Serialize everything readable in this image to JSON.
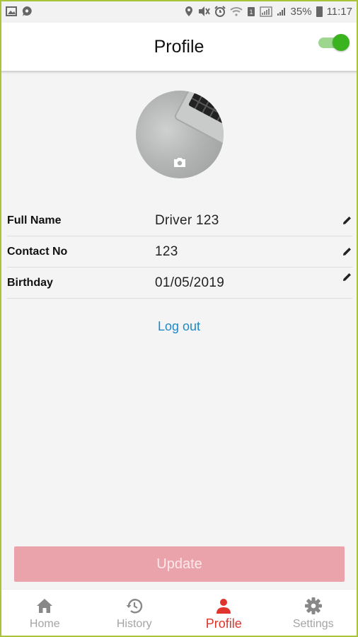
{
  "status_bar": {
    "battery_percent": "35%",
    "time": "11:17"
  },
  "header": {
    "title": "Profile",
    "toggle_on": true
  },
  "avatar": {
    "icon": "camera-icon"
  },
  "fields": [
    {
      "label": "Full Name",
      "value": "Driver 123"
    },
    {
      "label": "Contact No",
      "value": "123"
    },
    {
      "label": "Birthday",
      "value": "01/05/2019"
    }
  ],
  "logout_label": "Log out",
  "update_label": "Update",
  "nav": {
    "items": [
      {
        "label": "Home",
        "icon": "home-icon"
      },
      {
        "label": "History",
        "icon": "history-icon"
      },
      {
        "label": "Profile",
        "icon": "person-icon"
      },
      {
        "label": "Settings",
        "icon": "gear-icon"
      }
    ],
    "active": "Profile"
  },
  "colors": {
    "accent_red": "#e0332c",
    "link_blue": "#1e88c8",
    "toggle_green": "#3bb31f",
    "update_disabled": "#eaa3ab"
  }
}
